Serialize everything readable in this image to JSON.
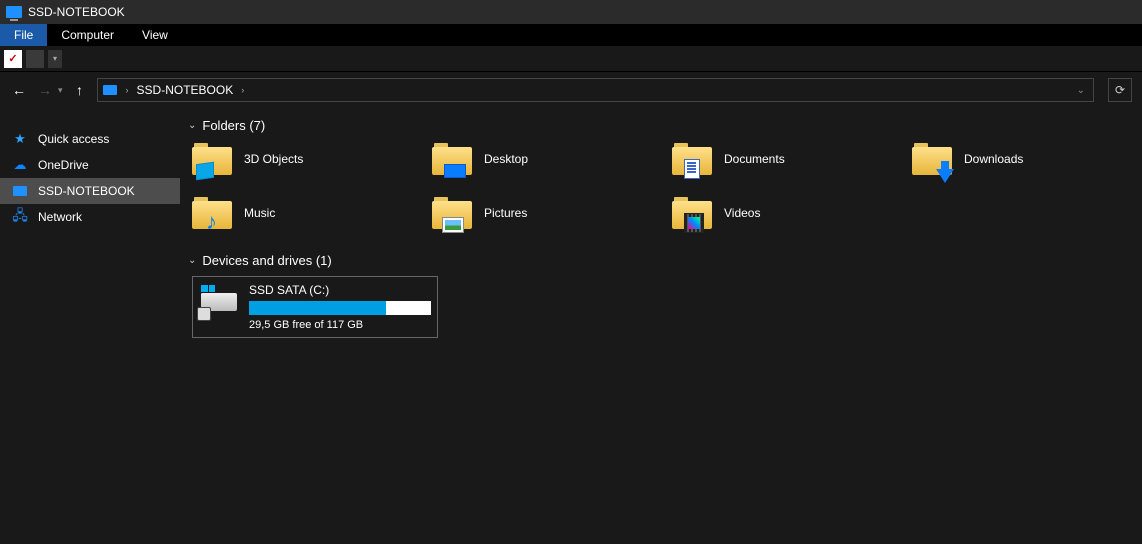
{
  "window": {
    "title": "SSD-NOTEBOOK"
  },
  "menu": {
    "file": "File",
    "computer": "Computer",
    "view": "View"
  },
  "breadcrumb": {
    "root": "SSD-NOTEBOOK"
  },
  "sidebar": {
    "quick": "Quick access",
    "onedrive": "OneDrive",
    "thispc": "SSD-NOTEBOOK",
    "network": "Network"
  },
  "groups": {
    "folders_label": "Folders (7)",
    "drives_label": "Devices and drives (1)"
  },
  "folders": {
    "objects3d": "3D Objects",
    "desktop": "Desktop",
    "documents": "Documents",
    "downloads": "Downloads",
    "music": "Music",
    "pictures": "Pictures",
    "videos": "Videos"
  },
  "drive": {
    "name": "SSD SATA (C:)",
    "subtitle": "29,5 GB free of 117 GB",
    "used_pct": 75
  }
}
